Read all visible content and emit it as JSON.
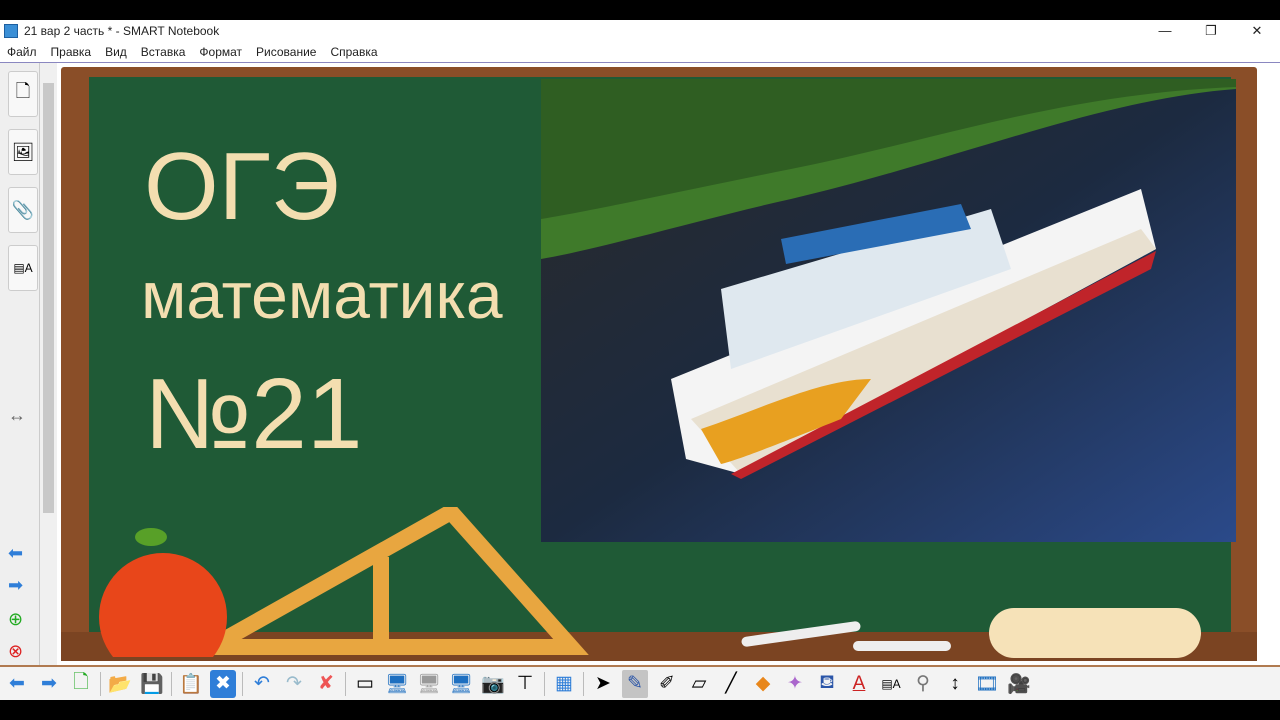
{
  "window": {
    "title": "21 вар 2 часть * - SMART Notebook",
    "minimize": "—",
    "restore": "❐",
    "close": "✕"
  },
  "menu": [
    "Файл",
    "Правка",
    "Вид",
    "Вставка",
    "Формат",
    "Рисование",
    "Справка"
  ],
  "slide": {
    "line1": "ОГЭ",
    "line2": "математика",
    "line3": "№21"
  },
  "colors": {
    "board": "#1f5a36",
    "frame": "#8a4e28",
    "text": "#f3deb0"
  }
}
